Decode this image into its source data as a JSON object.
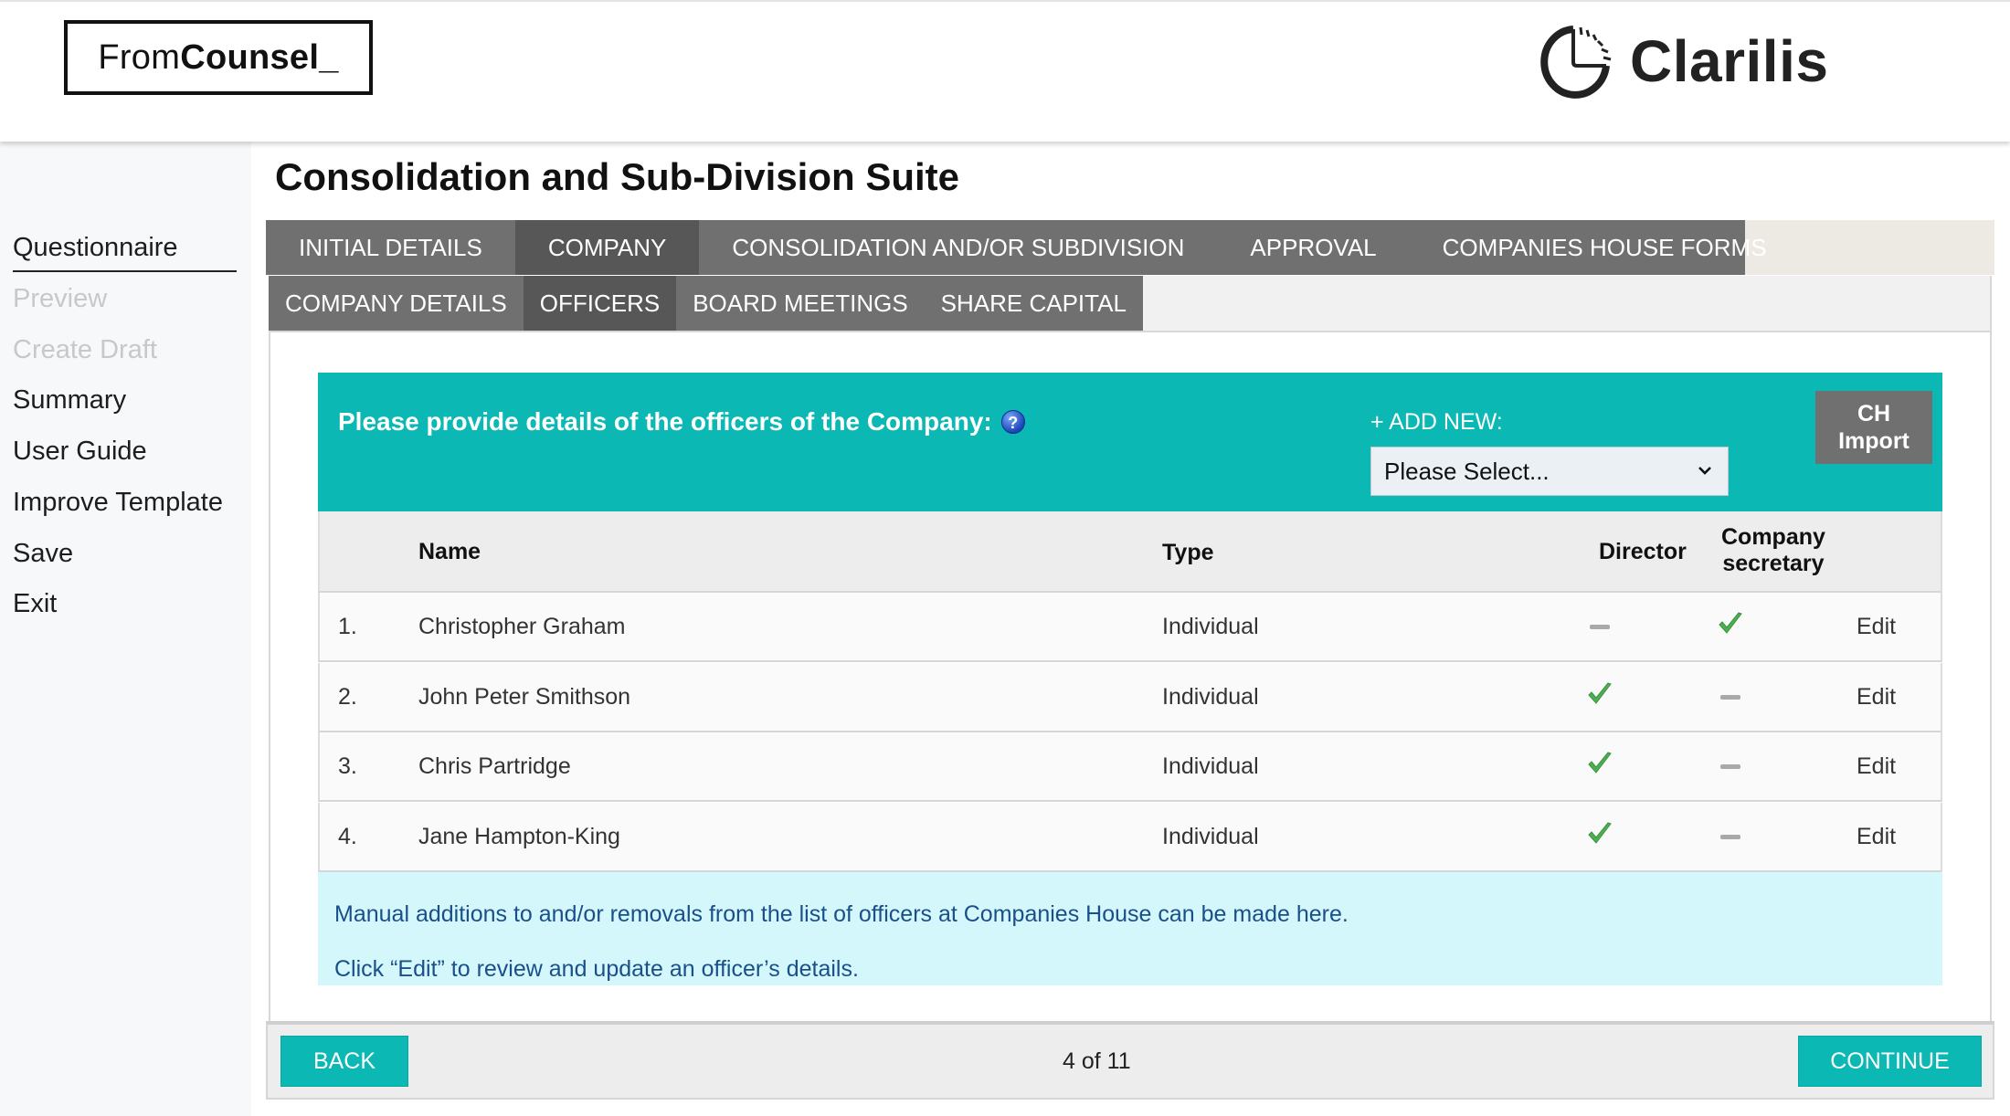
{
  "header": {
    "left_logo": {
      "light": "From",
      "bold": "Counsel_"
    },
    "right_logo": {
      "name": "Clarilis"
    }
  },
  "sidebar": {
    "items": [
      {
        "label": "Questionnaire",
        "state": "active"
      },
      {
        "label": "Preview",
        "state": "disabled"
      },
      {
        "label": "Create Draft",
        "state": "disabled"
      },
      {
        "label": "Summary",
        "state": "enabled"
      },
      {
        "label": "User Guide",
        "state": "enabled"
      },
      {
        "label": "Improve Template",
        "state": "enabled"
      },
      {
        "label": "Save",
        "state": "enabled"
      },
      {
        "label": "Exit",
        "state": "enabled"
      }
    ]
  },
  "page": {
    "title": "Consolidation and Sub-Division Suite"
  },
  "tabs": {
    "main": [
      {
        "label": "INITIAL DETAILS",
        "active": false
      },
      {
        "label": "COMPANY",
        "active": true
      },
      {
        "label": "CONSOLIDATION AND/OR SUBDIVISION",
        "active": false
      },
      {
        "label": "APPROVAL",
        "active": false
      },
      {
        "label": "COMPANIES HOUSE FORMS",
        "active": false
      }
    ],
    "sub": [
      {
        "label": "COMPANY DETAILS",
        "active": false
      },
      {
        "label": "OFFICERS",
        "active": true
      },
      {
        "label": "BOARD MEETINGS",
        "active": false
      },
      {
        "label": "SHARE CAPITAL",
        "active": false
      }
    ]
  },
  "officers_panel": {
    "question": "Please provide details of the officers of the Company:",
    "help_icon": "question-mark-icon",
    "add_new_label": "+ ADD NEW:",
    "add_new_select": {
      "selected": "Please Select..."
    },
    "ch_import": {
      "line1": "CH",
      "line2": "Import"
    }
  },
  "table": {
    "columns": {
      "name": "Name",
      "type": "Type",
      "director": "Director",
      "secretary_line1": "Company",
      "secretary_line2": "secretary"
    },
    "rows": [
      {
        "num": "1.",
        "name": "Christopher Graham",
        "type": "Individual",
        "director": false,
        "secretary": true,
        "action": "Edit"
      },
      {
        "num": "2.",
        "name": "John Peter Smithson",
        "type": "Individual",
        "director": true,
        "secretary": false,
        "action": "Edit"
      },
      {
        "num": "3.",
        "name": "Chris Partridge",
        "type": "Individual",
        "director": true,
        "secretary": false,
        "action": "Edit"
      },
      {
        "num": "4.",
        "name": "Jane Hampton-King",
        "type": "Individual",
        "director": true,
        "secretary": false,
        "action": "Edit"
      }
    ]
  },
  "info": {
    "line1": "Manual additions to and/or removals from the list of officers at Companies House can be made here.",
    "line2": "Click “Edit” to review and update an officer’s details."
  },
  "footer": {
    "back_label": "BACK",
    "page_counter": "4 of 11",
    "continue_label": "CONTINUE"
  },
  "colors": {
    "teal_accent": "#0bb8b4",
    "tab_gray": "#707070",
    "tab_active": "#575757",
    "check_green": "#4caf50",
    "info_bg": "#d4f7fc",
    "info_text": "#1a4f8a"
  }
}
